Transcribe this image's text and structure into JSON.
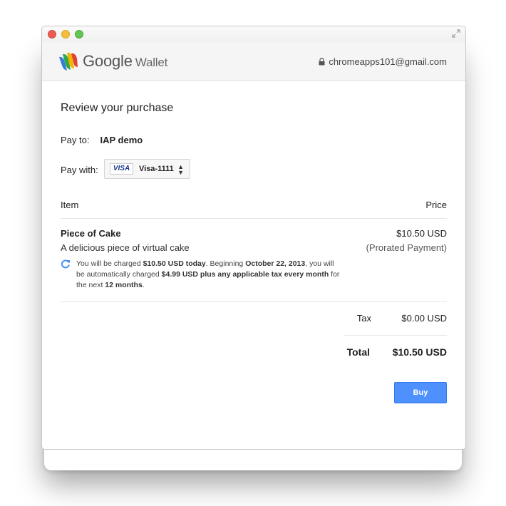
{
  "window": {
    "buttons": [
      "close",
      "minimize",
      "zoom"
    ]
  },
  "header": {
    "brand": "Google",
    "product": "Wallet",
    "account": "chromeapps101@gmail.com"
  },
  "purchase": {
    "title": "Review your purchase",
    "pay_to_label": "Pay to:",
    "pay_to_value": "IAP demo",
    "pay_with_label": "Pay with:",
    "card_brand": "VISA",
    "card_label": "Visa-1111"
  },
  "table": {
    "col_item": "Item",
    "col_price": "Price",
    "item_name": "Piece of Cake",
    "item_desc": "A delicious piece of virtual cake",
    "item_price": "$10.50 USD",
    "item_note": "(Prorated Payment)",
    "subscription_note": {
      "p1": "You will be charged ",
      "b1": "$10.50 USD today",
      "p2": ". Beginning ",
      "b2": "October 22, 2013",
      "p3": ", you will be automatically charged ",
      "b3": "$4.99 USD plus any applicable tax every month",
      "p4": " for the next ",
      "b4": "12 months",
      "p5": "."
    }
  },
  "summary": {
    "tax_label": "Tax",
    "tax_value": "$0.00 USD",
    "total_label": "Total",
    "total_value": "$10.50 USD"
  },
  "actions": {
    "buy_label": "Buy"
  },
  "colors": {
    "accent": "#4d90fe",
    "refresh": "#4a8ef5"
  }
}
